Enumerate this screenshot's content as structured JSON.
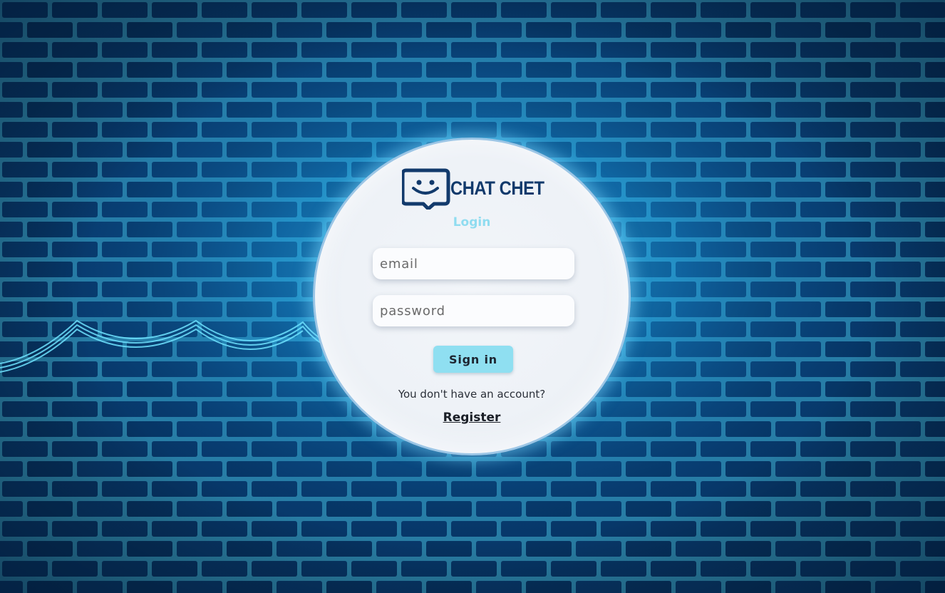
{
  "background": {
    "description_icon": "brick-wall-neon",
    "colors": {
      "base": "#06325f",
      "brick": "#0e4c86",
      "mortar": "#3fd2ff",
      "glow": "#2ab8ff"
    }
  },
  "brand": {
    "name": "CHAT CHET",
    "icon": "chat-bubble-smile-icon",
    "color": "#123a6c"
  },
  "login": {
    "title": "Login",
    "email_placeholder": "email",
    "password_placeholder": "password",
    "signin_label": "Sign in",
    "no_account_text": "You don't have an account?",
    "register_label": "Register"
  },
  "colors": {
    "accent": "#8fdff1",
    "title": "#8fdcf0"
  }
}
